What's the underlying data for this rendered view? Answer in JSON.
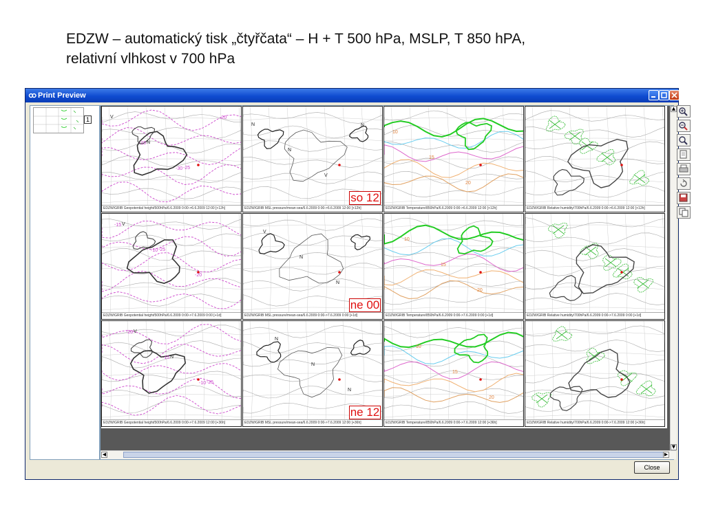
{
  "slide": {
    "title_line1": "EDZW – automatický tisk „čtyřčata“ – H + T 500 hPa, MSLP, T 850 hPA,",
    "title_line2": "relativní vlhkost v 700 hPa"
  },
  "window": {
    "title": "Print Preview",
    "close_label": "Close",
    "thumbnail_page": "1"
  },
  "grid": {
    "rows": [
      {
        "cells": [
          {
            "caption": "EDZW/GRIB Geopotential height/500hPa/6.6.2009 0:00->6.6.2009 12:00 [+12h]"
          },
          {
            "caption": "EDZW/GRIB MSL pressure/mean-sea/6.6.2009 0:00->6.6.2009 12:00 [+12h]",
            "stamp": "so 12"
          },
          {
            "caption": "EDZW/GRIB Temperature/850hPa/6.6.2009 0:00->6.6.2009 12:00 [+12h]"
          },
          {
            "caption": "EDZW/GRIB Relative humidity/700hPa/6.6.2009 0:00->6.6.2009 12:00 [+12h]"
          }
        ]
      },
      {
        "cells": [
          {
            "caption": "EDZW/GRIB Geopotential height/500hPa/6.6.2009 0:00->7.6.2009 0:00 [+1d]"
          },
          {
            "caption": "EDZW/GRIB MSL pressure/mean-sea/6.6.2009 0:00->7.6.2009 0:00 [+1d]",
            "stamp": "ne 00"
          },
          {
            "caption": "EDZW/GRIB Temperature/850hPa/6.6.2009 0:00->7.6.2009 0:00 [+1d]"
          },
          {
            "caption": "EDZW/GRIB Relative humidity/700hPa/6.6.2009 0:00->7.6.2009 0:00 [+1d]"
          }
        ]
      },
      {
        "cells": [
          {
            "caption": "EDZW/GRIB Geopotential height/500hPa/6.6.2009 0:00->7.6.2009 12:00 [+36h]"
          },
          {
            "caption": "EDZW/GRIB MSL pressure/mean-sea/6.6.2009 0:00->7.6.2009 12:00 [+36h]",
            "stamp": "ne 12"
          },
          {
            "caption": "EDZW/GRIB Temperature/850hPa/6.6.2009 0:00->7.6.2009 12:00 [+36h]"
          },
          {
            "caption": "EDZW/GRIB Relative humidity/700hPa/6.6.2009 0:00->7.6.2009 12:00 [+36h]"
          }
        ]
      }
    ]
  },
  "map_labels": {
    "geopotential_row1": [
      "V",
      "N",
      "-25",
      "-20",
      "-15",
      "-30"
    ],
    "msl_row1": [
      "N",
      "N",
      "V",
      "N"
    ],
    "temperature_row1": [
      "10",
      "15",
      "20"
    ],
    "geopotential_row2": [
      "V",
      "-25",
      "-20",
      "-15",
      "-10"
    ],
    "msl_row2": [
      "V",
      "N",
      "N"
    ],
    "temperature_row2": [
      "10",
      "15",
      "20"
    ],
    "geopotential_row3": [
      "V",
      "N",
      "-25",
      "-20",
      "-15",
      "-10"
    ],
    "msl_row3": [
      "N",
      "N",
      "N"
    ],
    "temperature_row3": [
      "10",
      "15",
      "20"
    ]
  },
  "toolbar_icons": [
    "zoom-in-icon",
    "zoom-out-icon",
    "zoom-fit-icon",
    "page-icon",
    "print-icon",
    "refresh-icon",
    "save-icon",
    "copy-icon"
  ],
  "colors": {
    "titlebar": "#0f4bd0",
    "stamp": "#e01010",
    "geopotential_dash": "#cc44cc",
    "temperature_green": "#22cc22",
    "humidity_hatch": "#33bb33"
  }
}
